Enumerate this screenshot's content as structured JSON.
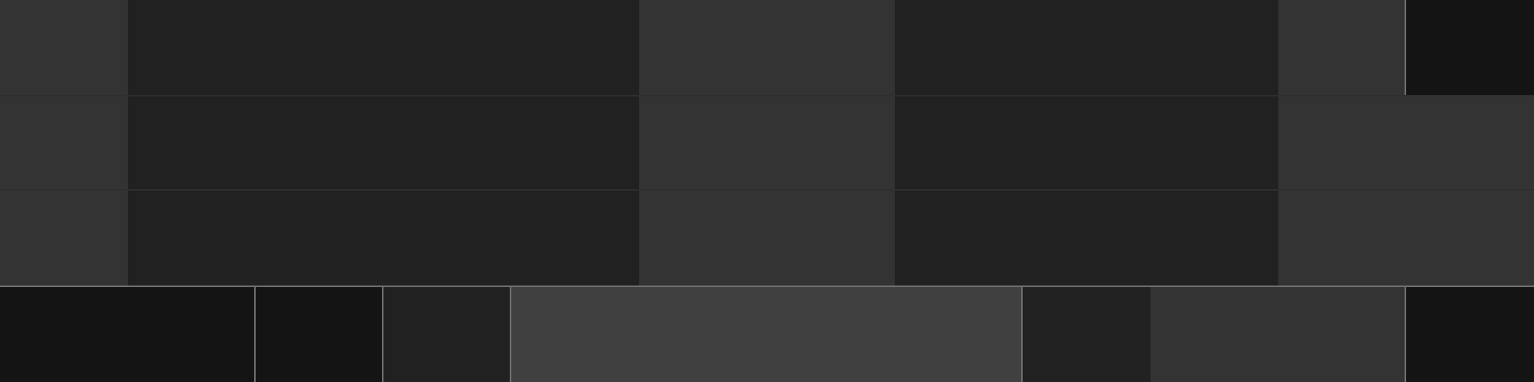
{
  "grid": {
    "row1": [
      {
        "name": "grid-cell-r1-c1",
        "tone": "mid"
      },
      {
        "name": "grid-cell-r1-c2",
        "tone": "dark"
      },
      {
        "name": "grid-cell-r1-c3",
        "tone": "mid"
      },
      {
        "name": "grid-cell-r1-c4",
        "tone": "dark"
      },
      {
        "name": "grid-cell-r1-c5",
        "tone": "mid"
      },
      {
        "name": "grid-cell-r1-c6-selected",
        "tone": "black"
      }
    ],
    "row2": [
      {
        "name": "grid-cell-r2-c1",
        "tone": "mid"
      },
      {
        "name": "grid-cell-r2-c2",
        "tone": "dark"
      },
      {
        "name": "grid-cell-r2-c3",
        "tone": "mid"
      },
      {
        "name": "grid-cell-r2-c4",
        "tone": "dark"
      },
      {
        "name": "grid-cell-r2-c5",
        "tone": "mid"
      }
    ],
    "row3": [
      {
        "name": "grid-cell-r3-c1",
        "tone": "mid"
      },
      {
        "name": "grid-cell-r3-c2",
        "tone": "dark"
      },
      {
        "name": "grid-cell-r3-c3",
        "tone": "mid"
      },
      {
        "name": "grid-cell-r3-c4",
        "tone": "dark"
      },
      {
        "name": "grid-cell-r3-c5",
        "tone": "mid"
      }
    ]
  },
  "bottom_bar": {
    "segments": [
      {
        "name": "bottom-segment-1",
        "tone": "black"
      },
      {
        "name": "bottom-segment-2",
        "tone": "black"
      },
      {
        "name": "bottom-segment-3",
        "tone": "dark"
      },
      {
        "name": "bottom-segment-4-active",
        "tone": "light"
      },
      {
        "name": "bottom-segment-5",
        "tone": "dark"
      },
      {
        "name": "bottom-segment-6",
        "tone": "mid"
      },
      {
        "name": "bottom-segment-7",
        "tone": "black"
      }
    ]
  },
  "colors": {
    "mid": "#333333",
    "dark": "#212121",
    "black": "#141414",
    "light": "#404040",
    "border": "#6e6e6e",
    "grid_line": "#2e2e2e"
  }
}
